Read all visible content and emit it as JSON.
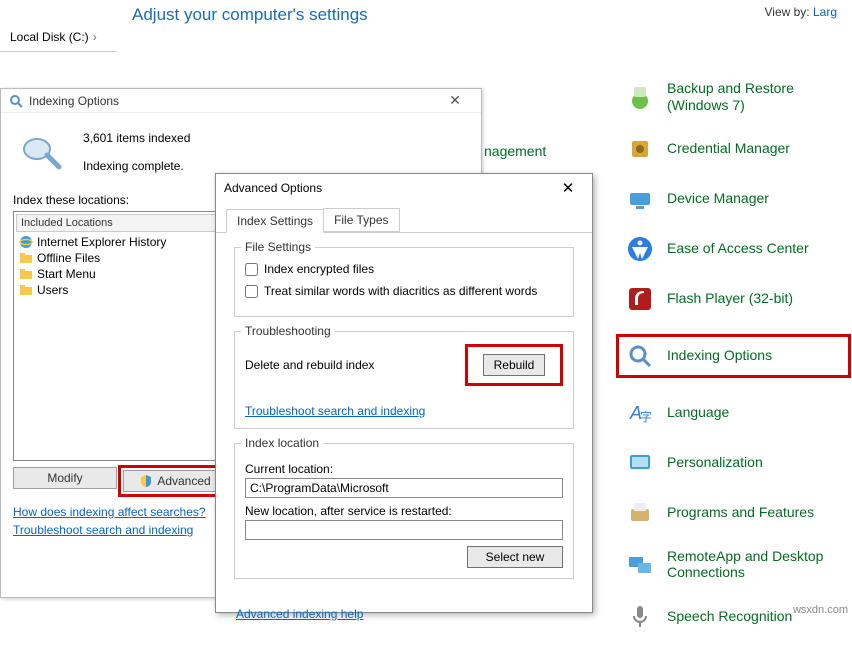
{
  "topbar": {
    "title": "Adjust your computer's settings",
    "viewby_label": "View by:",
    "viewby_value": "Larg"
  },
  "explorer": {
    "path": "Local Disk (C:)",
    "chev": "›"
  },
  "fragment_text": "nagement",
  "cplist": {
    "items": [
      {
        "label": "Backup and Restore (Windows 7)",
        "hl": false
      },
      {
        "label": "Credential Manager",
        "hl": false
      },
      {
        "label": "Device Manager",
        "hl": false
      },
      {
        "label": "Ease of Access Center",
        "hl": false
      },
      {
        "label": "Flash Player (32-bit)",
        "hl": false
      },
      {
        "label": "Indexing Options",
        "hl": true
      },
      {
        "label": "Language",
        "hl": false
      },
      {
        "label": "Personalization",
        "hl": false
      },
      {
        "label": "Programs and Features",
        "hl": false
      },
      {
        "label": "RemoteApp and Desktop Connections",
        "hl": false
      },
      {
        "label": "Speech Recognition",
        "hl": false
      }
    ]
  },
  "idx": {
    "title": "Indexing Options",
    "count_line": "3,601 items indexed",
    "status_line": "Indexing complete.",
    "list_label": "Index these locations:",
    "list_header": "Included Locations",
    "locations": [
      "Internet Explorer History",
      "Offline Files",
      "Start Menu",
      "Users"
    ],
    "btn_modify": "Modify",
    "btn_advanced": "Advanced",
    "link1": "How does indexing affect searches?",
    "link2": "Troubleshoot search and indexing"
  },
  "adv": {
    "title": "Advanced Options",
    "tab1": "Index Settings",
    "tab2": "File Types",
    "grp_file": "File Settings",
    "chk1": "Index encrypted files",
    "chk2": "Treat similar words with diacritics as different words",
    "grp_trouble": "Troubleshooting",
    "trouble_text": "Delete and rebuild index",
    "btn_rebuild": "Rebuild",
    "trouble_link": "Troubleshoot search and indexing",
    "grp_loc": "Index location",
    "loc_current_lbl": "Current location:",
    "loc_current_val": "C:\\ProgramData\\Microsoft",
    "loc_new_lbl": "New location, after service is restarted:",
    "loc_new_val": "",
    "btn_selectnew": "Select new",
    "bottom_link": "Advanced indexing help"
  },
  "watermark": "wsxdn.com"
}
